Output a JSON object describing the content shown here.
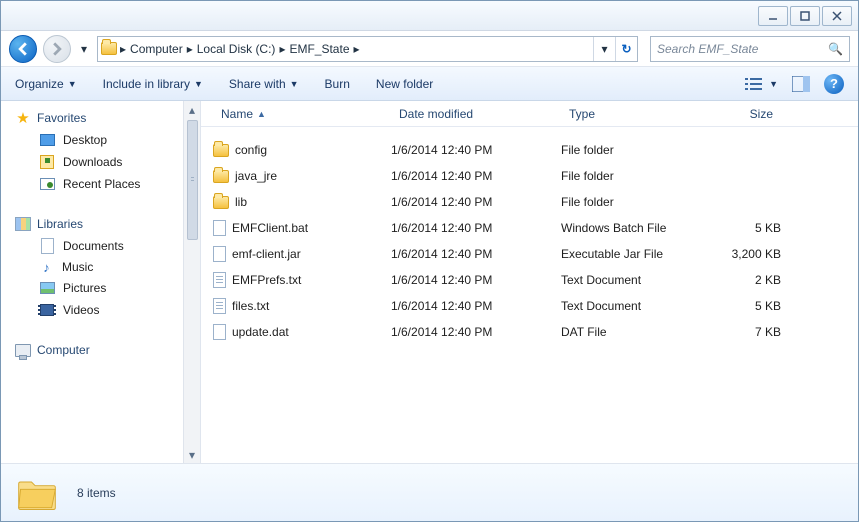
{
  "breadcrumb": [
    "Computer",
    "Local Disk (C:)",
    "EMF_State"
  ],
  "search_placeholder": "Search EMF_State",
  "toolbar": {
    "organize": "Organize",
    "include": "Include in library",
    "share": "Share with",
    "burn": "Burn",
    "newfolder": "New folder"
  },
  "columns": {
    "name": "Name",
    "date": "Date modified",
    "type": "Type",
    "size": "Size"
  },
  "sidebar": {
    "favorites": {
      "label": "Favorites",
      "items": [
        "Desktop",
        "Downloads",
        "Recent Places"
      ]
    },
    "libraries": {
      "label": "Libraries",
      "items": [
        "Documents",
        "Music",
        "Pictures",
        "Videos"
      ]
    },
    "computer": {
      "label": "Computer"
    }
  },
  "files": [
    {
      "icon": "folder",
      "name": "config",
      "date": "1/6/2014 12:40 PM",
      "type": "File folder",
      "size": ""
    },
    {
      "icon": "folder",
      "name": "java_jre",
      "date": "1/6/2014 12:40 PM",
      "type": "File folder",
      "size": ""
    },
    {
      "icon": "folder",
      "name": "lib",
      "date": "1/6/2014 12:40 PM",
      "type": "File folder",
      "size": ""
    },
    {
      "icon": "file",
      "name": "EMFClient.bat",
      "date": "1/6/2014 12:40 PM",
      "type": "Windows Batch File",
      "size": "5 KB"
    },
    {
      "icon": "file",
      "name": "emf-client.jar",
      "date": "1/6/2014 12:40 PM",
      "type": "Executable Jar File",
      "size": "3,200 KB"
    },
    {
      "icon": "text",
      "name": "EMFPrefs.txt",
      "date": "1/6/2014 12:40 PM",
      "type": "Text Document",
      "size": "2 KB"
    },
    {
      "icon": "text",
      "name": "files.txt",
      "date": "1/6/2014 12:40 PM",
      "type": "Text Document",
      "size": "5 KB"
    },
    {
      "icon": "file",
      "name": "update.dat",
      "date": "1/6/2014 12:40 PM",
      "type": "DAT File",
      "size": "7 KB"
    }
  ],
  "status": "8 items"
}
